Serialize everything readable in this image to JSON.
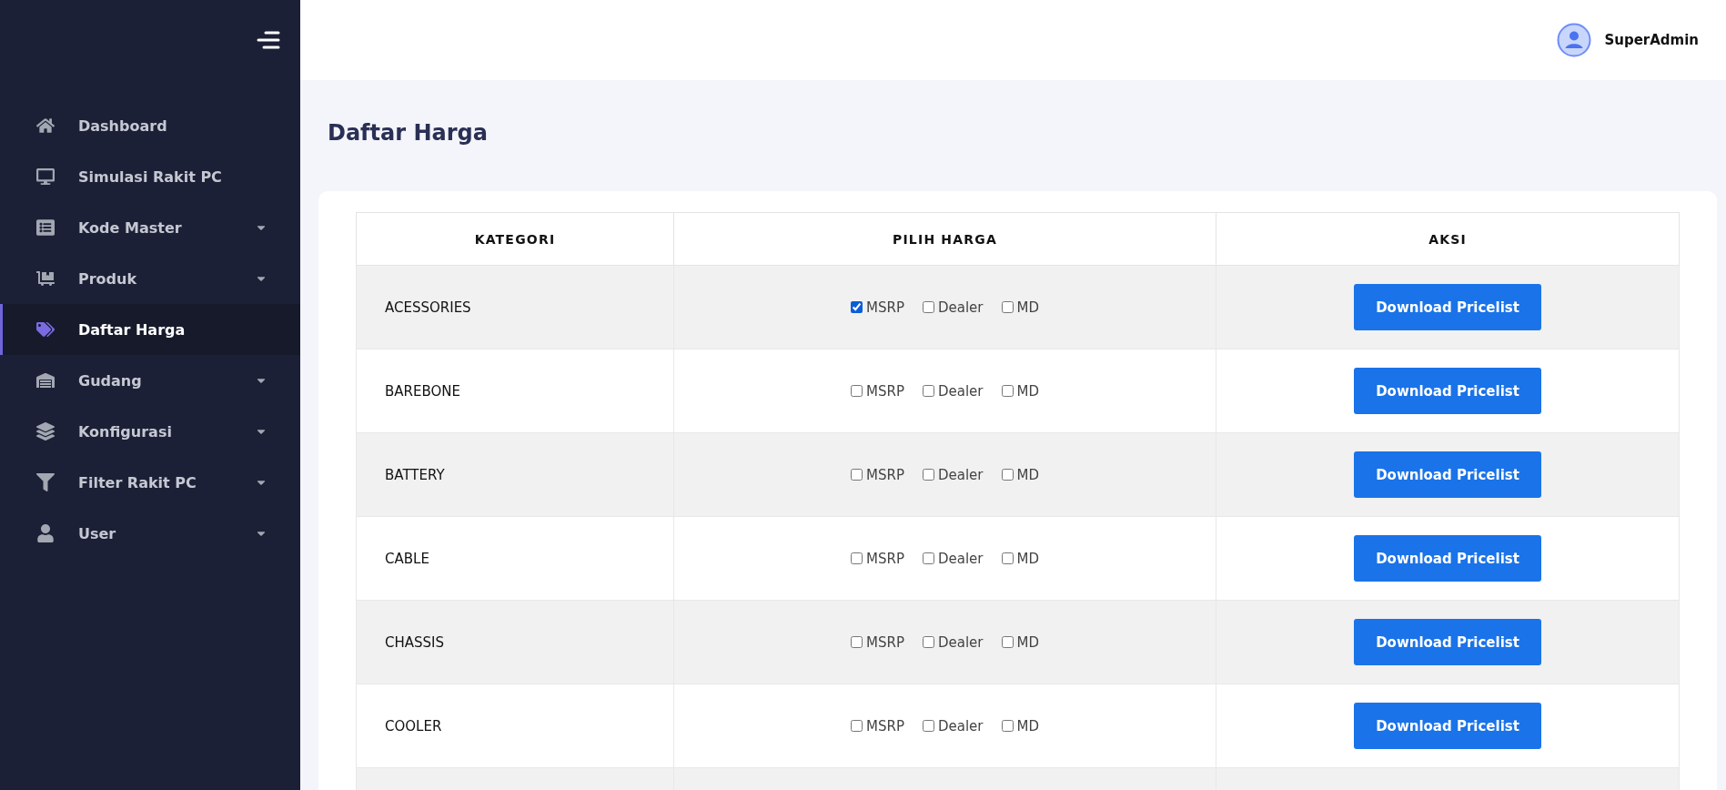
{
  "sidebar": {
    "items": [
      {
        "label": "Dashboard",
        "selected": false,
        "expandable": false
      },
      {
        "label": "Simulasi Rakit PC",
        "selected": false,
        "expandable": false
      },
      {
        "label": "Kode Master",
        "selected": false,
        "expandable": true
      },
      {
        "label": "Produk",
        "selected": false,
        "expandable": true
      },
      {
        "label": "Daftar Harga",
        "selected": true,
        "expandable": false
      },
      {
        "label": "Gudang",
        "selected": false,
        "expandable": true
      },
      {
        "label": "Konfigurasi",
        "selected": false,
        "expandable": true
      },
      {
        "label": "Filter Rakit PC",
        "selected": false,
        "expandable": true
      },
      {
        "label": "User",
        "selected": false,
        "expandable": true
      }
    ]
  },
  "header": {
    "user": "SuperAdmin"
  },
  "page_title": "Daftar Harga",
  "table": {
    "columns": [
      "KATEGORI",
      "PILIH HARGA",
      "AKSI"
    ],
    "rows": [
      {
        "category": "ACESSORIES",
        "options": [
          {
            "label": "MSRP",
            "checked": true
          },
          {
            "label": "Dealer",
            "checked": false
          },
          {
            "label": "MD",
            "checked": false
          }
        ],
        "action": "Download Pricelist"
      },
      {
        "category": "BAREBONE",
        "options": [
          {
            "label": "MSRP",
            "checked": false
          },
          {
            "label": "Dealer",
            "checked": false
          },
          {
            "label": "MD",
            "checked": false
          }
        ],
        "action": "Download Pricelist"
      },
      {
        "category": "BATTERY",
        "options": [
          {
            "label": "MSRP",
            "checked": false
          },
          {
            "label": "Dealer",
            "checked": false
          },
          {
            "label": "MD",
            "checked": false
          }
        ],
        "action": "Download Pricelist"
      },
      {
        "category": "CABLE",
        "options": [
          {
            "label": "MSRP",
            "checked": false
          },
          {
            "label": "Dealer",
            "checked": false
          },
          {
            "label": "MD",
            "checked": false
          }
        ],
        "action": "Download Pricelist"
      },
      {
        "category": "CHASSIS",
        "options": [
          {
            "label": "MSRP",
            "checked": false
          },
          {
            "label": "Dealer",
            "checked": false
          },
          {
            "label": "MD",
            "checked": false
          }
        ],
        "action": "Download Pricelist"
      },
      {
        "category": "COOLER",
        "options": [
          {
            "label": "MSRP",
            "checked": false
          },
          {
            "label": "Dealer",
            "checked": false
          },
          {
            "label": "MD",
            "checked": false
          }
        ],
        "action": "Download Pricelist"
      }
    ]
  }
}
